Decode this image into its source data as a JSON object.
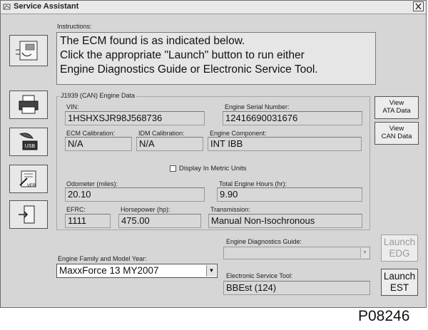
{
  "window": {
    "title": "Service Assistant"
  },
  "instructions": {
    "label": "Instructions:",
    "lines": [
      "The ECM found is as indicated below.",
      "Click the appropriate \"Launch\" button to run either",
      "Engine Diagnostics Guide or Electronic Service Tool."
    ]
  },
  "engine_data": {
    "group_title": "J1939 (CAN) Engine Data",
    "vin_label": "VIN:",
    "vin": "1HSHXSJR98J568736",
    "serial_label": "Engine Serial Number:",
    "serial": "12416690031676",
    "ecm_cal_label": "ECM Calibration:",
    "ecm_cal": "N/A",
    "idm_cal_label": "IDM Calibration:",
    "idm_cal": "N/A",
    "component_label": "Engine Component:",
    "component": "INT   IBB",
    "metric_label": "Display In Metric Units",
    "odometer_label": "Odometer (miles):",
    "odometer": "20.10",
    "hours_label": "Total Engine Hours (hr):",
    "hours": "9.90",
    "efrc_label": "EFRC:",
    "efrc": "1111",
    "hp_label": "Horsepower (hp):",
    "hp": "475.00",
    "transmission_label": "Transmission:",
    "transmission": "Manual Non-Isochronous"
  },
  "buttons": {
    "view_ata_1": "View",
    "view_ata_2": "ATA Data",
    "view_can_1": "View",
    "view_can_2": "CAN Data",
    "launch_edg_1": "Launch",
    "launch_edg_2": "EDG",
    "launch_est_1": "Launch",
    "launch_est_2": "EST"
  },
  "engine_family": {
    "label": "Engine Family and Model Year:",
    "value": "MaxxForce 13 MY2007"
  },
  "edg": {
    "label": "Engine Diagnostics Guide:",
    "value": ""
  },
  "est": {
    "label": "Electronic Service Tool:",
    "value": "BBEst (124)"
  },
  "figure_label": "P08246",
  "icons": [
    "app-icon",
    "close-icon",
    "ecm-icon",
    "printer-icon",
    "usb-icon",
    "version-icon",
    "exit-icon"
  ]
}
